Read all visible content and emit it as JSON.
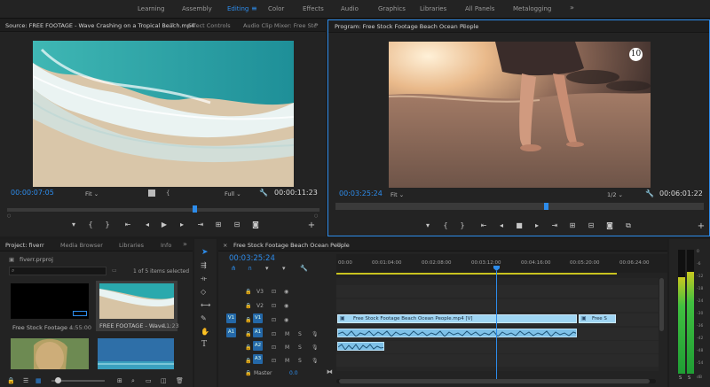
{
  "workspaces": {
    "items": [
      "Learning",
      "Assembly",
      "Editing",
      "Color",
      "Effects",
      "Audio",
      "Graphics",
      "Libraries",
      "All Panels",
      "Metalogging"
    ],
    "active": "Editing"
  },
  "source_monitor": {
    "tabs": [
      "Source: FREE FOOTAGE - Wave Crashing on a Tropical Beach.mp4",
      "Effect Controls",
      "Audio Clip Mixer: Free Stc"
    ],
    "current_time": "00:00:07:05",
    "fit": "Fit",
    "quality": "Full",
    "duration": "00:00:11:23",
    "playhead_fraction": 0.6
  },
  "program_monitor": {
    "tab": "Program: Free Stock Footage Beach Ocean People",
    "current_time": "00:03:25:24",
    "fit": "Fit",
    "quality": "1/2",
    "duration": "00:06:01:22",
    "badge": "10",
    "playhead_fraction": 0.57
  },
  "project": {
    "tabs": [
      "Project: fiverr",
      "Media Browser",
      "Libraries",
      "Info"
    ],
    "file": "fiverr.prproj",
    "selection_status": "1 of 5 items selected",
    "items": [
      {
        "name": "Free Stock Footage ...",
        "duration": "4:55:00"
      },
      {
        "name": "FREE FOOTAGE - Wave...",
        "duration": "11:23"
      }
    ]
  },
  "timeline": {
    "tab": "Free Stock Footage Beach Ocean People",
    "current_time": "00:03:25:24",
    "ruler": [
      "00:00",
      "00:01:04:00",
      "00:02:08:00",
      "00:03:12:00",
      "00:04:16:00",
      "00:05:20:00",
      "00:06:24:00"
    ],
    "video_tracks": [
      {
        "name": "V3",
        "src": ""
      },
      {
        "name": "V2",
        "src": ""
      },
      {
        "name": "V1",
        "src": "V1"
      }
    ],
    "audio_tracks": [
      {
        "name": "A1",
        "src": "A1"
      },
      {
        "name": "A2",
        "src": ""
      },
      {
        "name": "A3",
        "src": ""
      }
    ],
    "master": {
      "label": "Master",
      "value": "0.0"
    },
    "mute_label": "M",
    "solo_label": "S",
    "clips": {
      "v1_main": "Free Stock Footage Beach Ocean People.mp4 [V]",
      "v1_second": "Free S"
    }
  },
  "audio_meter": {
    "scale": [
      "0",
      "-6",
      "-12",
      "-18",
      "-24",
      "-30",
      "-36",
      "-42",
      "-48",
      "-54"
    ],
    "channels": [
      "S",
      "S"
    ],
    "db_label": "dB",
    "levels": [
      0.78,
      0.82
    ]
  },
  "tools": [
    "selection",
    "track-select-forward",
    "ripple-edit",
    "razor",
    "slip",
    "pen",
    "hand",
    "type"
  ],
  "colors": {
    "accent": "#2d8ceb",
    "clip_video": "#9fd5f3",
    "clip_audio": "#7ec1e8",
    "play_range": "#c9c31f"
  }
}
